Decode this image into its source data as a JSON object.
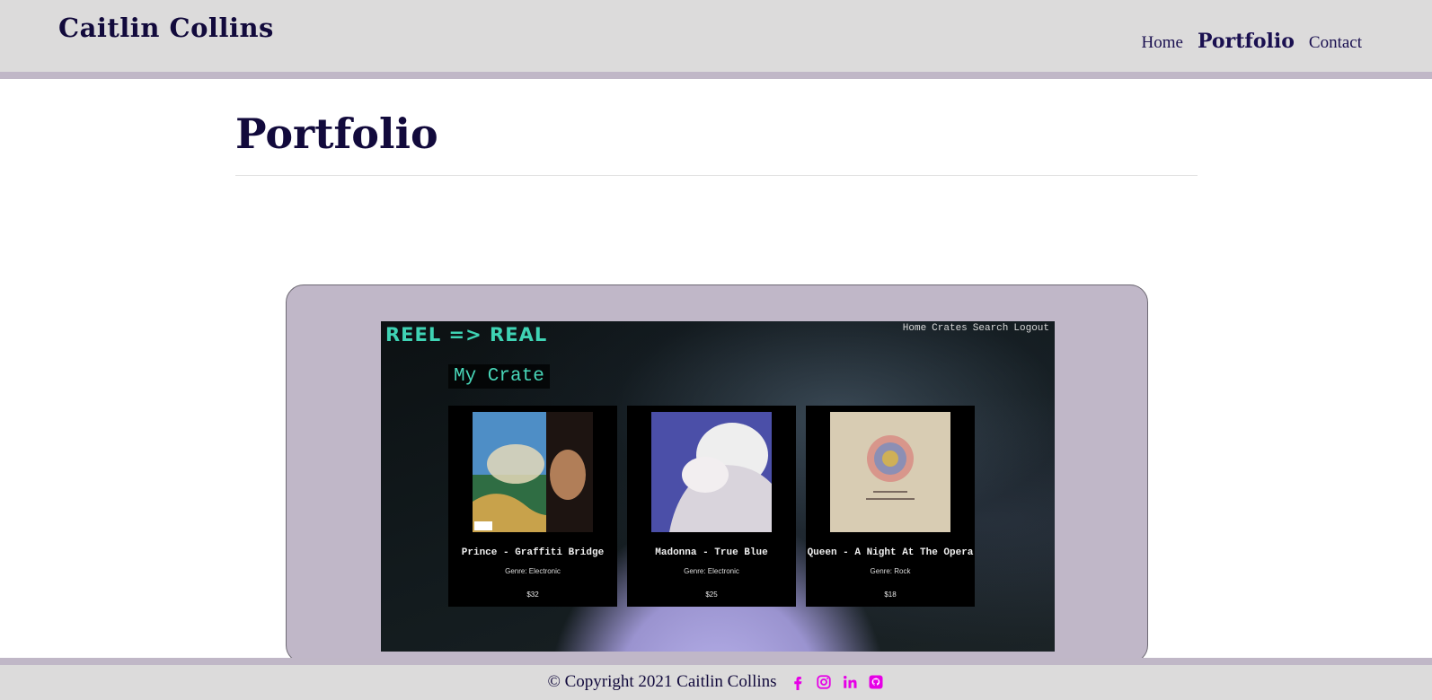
{
  "header": {
    "brand": "Caitlin Collins",
    "nav": [
      {
        "label": "Home"
      },
      {
        "label": "Portfolio",
        "active": true
      },
      {
        "label": "Contact"
      }
    ]
  },
  "main": {
    "title": "Portfolio",
    "project": {
      "screenshot": {
        "logo": "REEL => REAL",
        "nav": [
          "Home",
          "Crates",
          "Search",
          "Logout"
        ],
        "crate_title": "My Crate",
        "albums": [
          {
            "title": "Prince - Graffiti Bridge",
            "genre": "Genre: Electronic",
            "price": "$32"
          },
          {
            "title": "Madonna - True Blue",
            "genre": "Genre: Electronic",
            "price": "$25"
          },
          {
            "title": "Queen - A Night At The Opera",
            "genre": "Genre: Rock",
            "price": "$18"
          }
        ]
      }
    }
  },
  "footer": {
    "copyright": "© Copyright 2021 Caitlin Collins",
    "social": [
      "facebook-icon",
      "instagram-icon",
      "linkedin-icon",
      "github-icon"
    ]
  },
  "colors": {
    "header_bg": "#dcdbdb",
    "accent_border": "#c0b7c7",
    "brand_text": "#120a3c",
    "social_icon": "#e600e6",
    "logo_teal": "#3fd3b4"
  }
}
